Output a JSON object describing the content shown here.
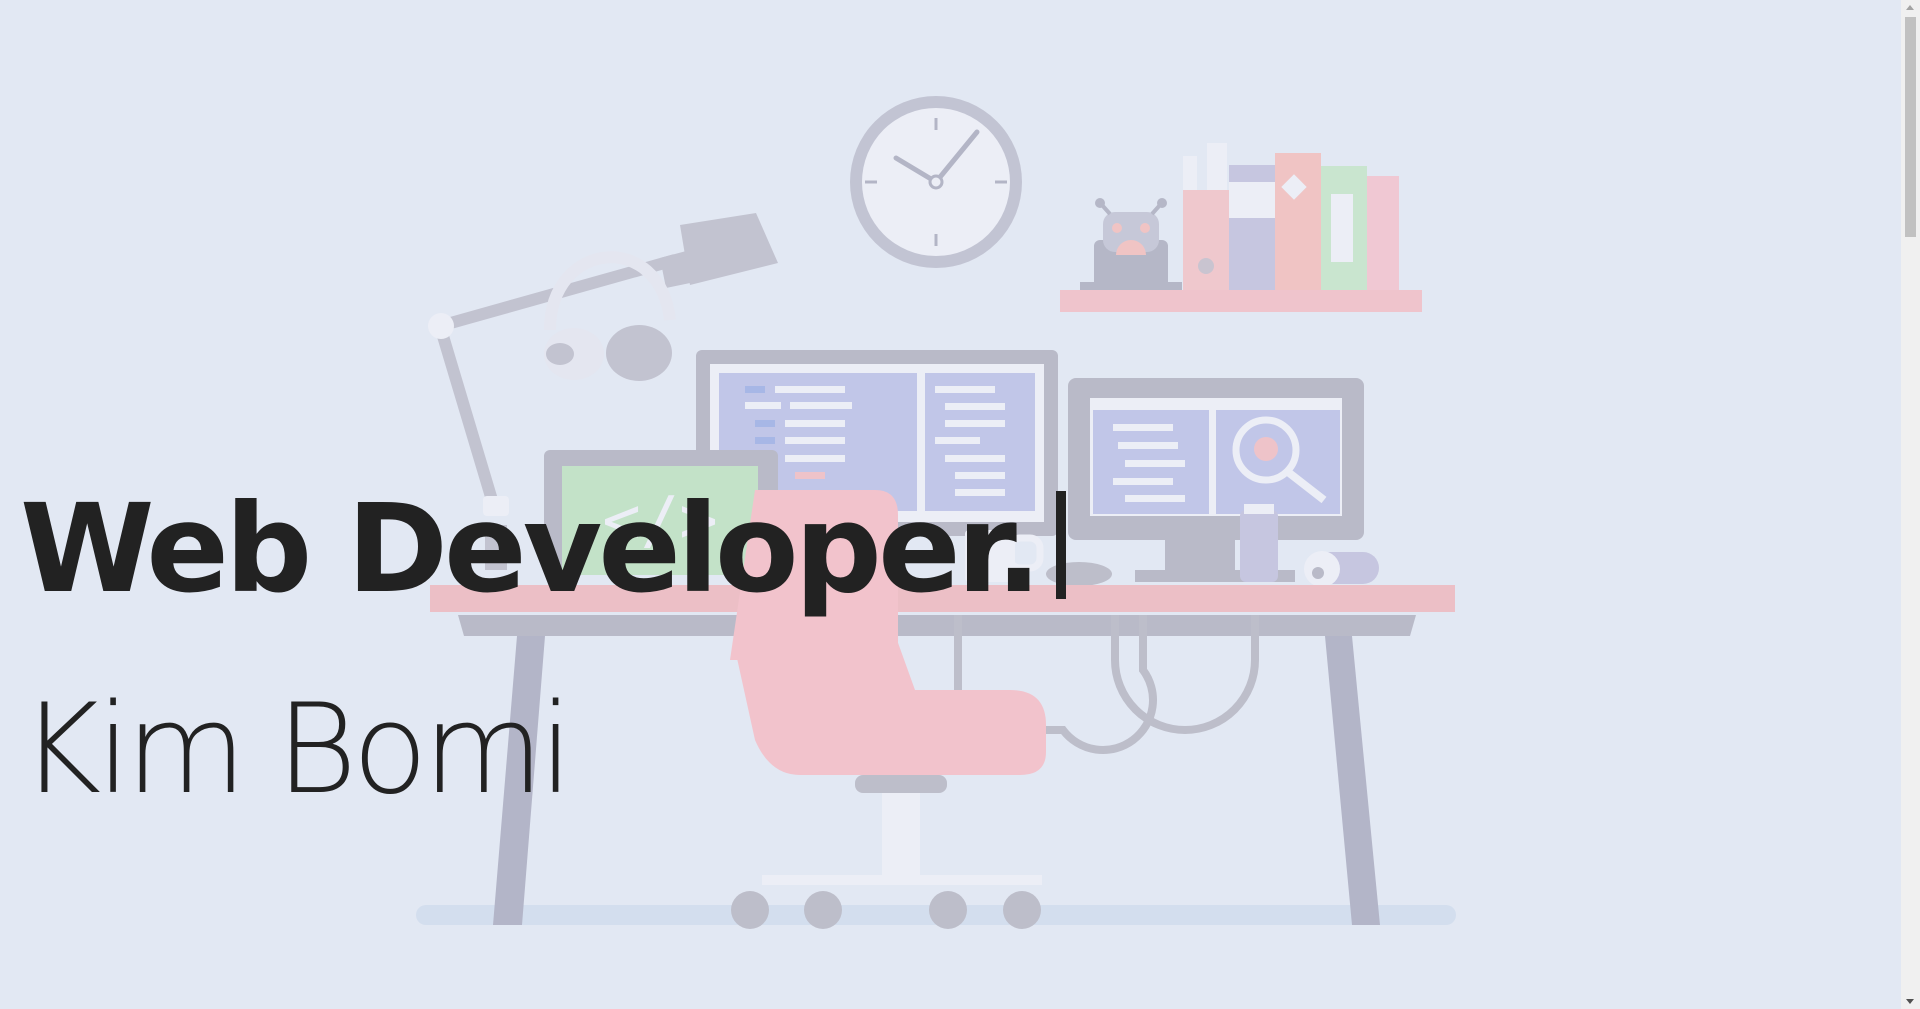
{
  "hero": {
    "title": "Web Developer.",
    "name": "Kim Bomi",
    "illustration_label": "workspace-illustration"
  },
  "colors": {
    "background": "#e2e8f3",
    "text": "#222222",
    "accent_pink": "#f2c3cc",
    "desk_top": "#ecbfc6",
    "screen_blue": "#c3c8ea",
    "frame_gray": "#b4b5c2"
  },
  "scrollbar": {
    "position_fraction": 0.0
  }
}
